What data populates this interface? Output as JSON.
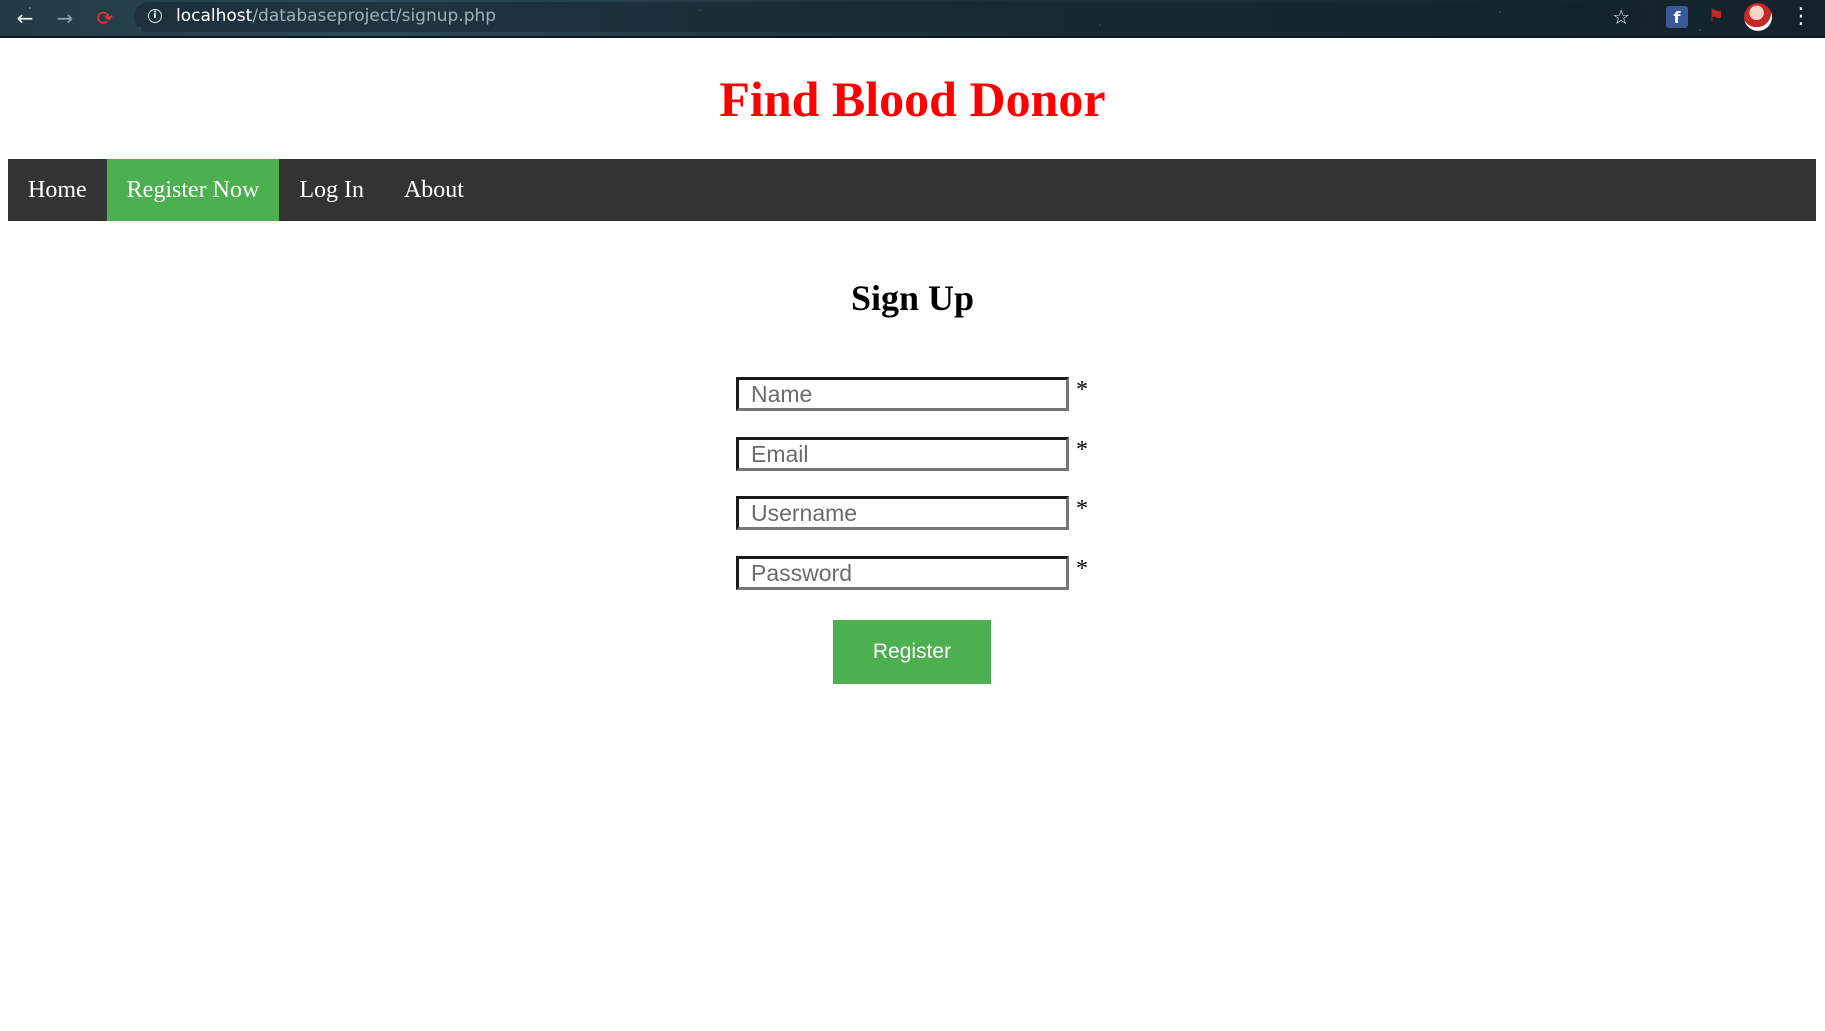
{
  "browser": {
    "url_host": "localhost",
    "url_path": "/databaseproject/signup.php"
  },
  "site": {
    "title": "Find Blood Donor"
  },
  "nav": {
    "items": [
      {
        "label": "Home"
      },
      {
        "label": "Register Now",
        "active": true
      },
      {
        "label": "Log In"
      },
      {
        "label": "About"
      }
    ]
  },
  "form": {
    "title": "Sign Up",
    "fields": [
      {
        "placeholder": "Name",
        "value": "",
        "required_mark": "*"
      },
      {
        "placeholder": "Email",
        "value": "",
        "required_mark": "*"
      },
      {
        "placeholder": "Username",
        "value": "",
        "required_mark": "*"
      },
      {
        "placeholder": "Password",
        "value": "",
        "required_mark": "*"
      }
    ],
    "submit_label": "Register"
  },
  "colors": {
    "title": "#ff0000",
    "navbar_bg": "#333333",
    "accent": "#4caf50"
  },
  "icons": [
    "back-arrow-icon",
    "forward-arrow-icon",
    "reload-icon",
    "info-icon",
    "star-icon",
    "facebook-icon",
    "extension-icon",
    "avatar",
    "menu-icon"
  ]
}
